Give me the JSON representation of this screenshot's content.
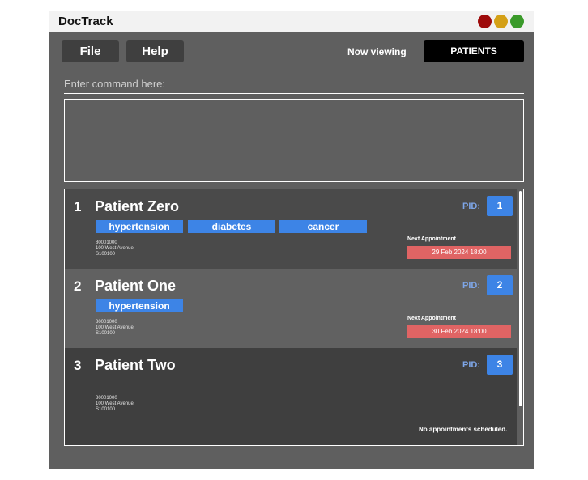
{
  "app": {
    "title": "DocTrack"
  },
  "menu": {
    "file": "File",
    "help": "Help"
  },
  "viewing": {
    "label": "Now viewing",
    "current": "PATIENTS"
  },
  "command": {
    "placeholder": "Enter command here:",
    "value": ""
  },
  "result": {
    "text": ""
  },
  "patients": [
    {
      "index": "1",
      "name": "Patient Zero",
      "pid_label": "PID:",
      "pid": "1",
      "tags": [
        "hypertension",
        "diabetes",
        "cancer"
      ],
      "phone": "80001000",
      "address": "100 West Avenue",
      "postal": "S100100",
      "appointment_label": "Next Appointment",
      "appointment": "29 Feb 2024 18:00"
    },
    {
      "index": "2",
      "name": "Patient One",
      "pid_label": "PID:",
      "pid": "2",
      "tags": [
        "hypertension"
      ],
      "phone": "80001000",
      "address": "100 West Avenue",
      "postal": "S100100",
      "appointment_label": "Next Appointment",
      "appointment": "30 Feb 2024 18:00"
    },
    {
      "index": "3",
      "name": "Patient Two",
      "pid_label": "PID:",
      "pid": "3",
      "tags": [],
      "phone": "80001000",
      "address": "100 West Avenue",
      "postal": "S100100",
      "no_appointment": "No appointments scheduled."
    }
  ],
  "colors": {
    "window_bg": "#5f5f5f",
    "tag_blue": "#3d84e6",
    "appointment_red": "#e06464",
    "close": "#9e0b0b",
    "minimize": "#d4a017",
    "maximize": "#3a9a2a"
  }
}
